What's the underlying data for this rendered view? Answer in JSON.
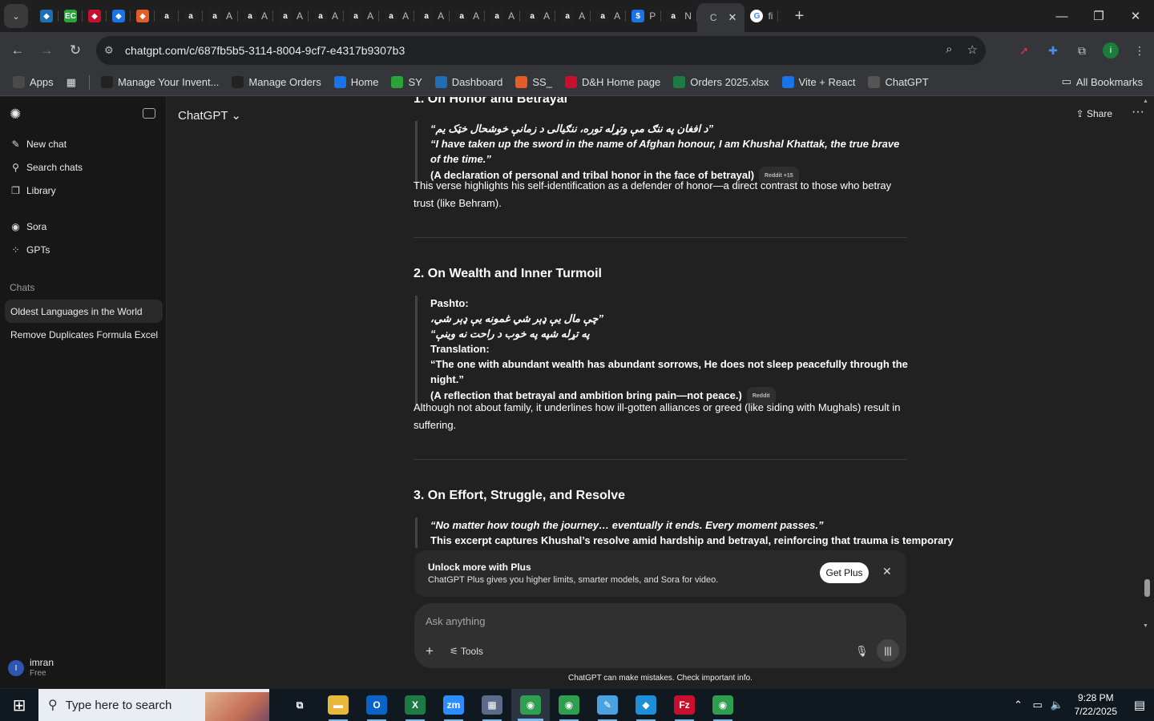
{
  "browser": {
    "tabs": [
      {
        "icon": "diamond-icon",
        "title": "",
        "color": "#1e6fb3"
      },
      {
        "icon": "ec-icon",
        "title": "",
        "color": "#2aa33b"
      },
      {
        "icon": "dh-icon",
        "title": "",
        "color": "#c8102e"
      },
      {
        "icon": "logo-icon",
        "title": "",
        "color": "#1a73e8"
      },
      {
        "icon": "stack-icon",
        "title": "",
        "color": "#e25d28"
      },
      {
        "icon": "amazon-icon",
        "title": "",
        "color": "#222222"
      },
      {
        "icon": "amazon-icon",
        "title": "",
        "color": "#222222"
      },
      {
        "icon": "amazon-icon",
        "title": "A",
        "color": "#222222"
      },
      {
        "icon": "amazon-icon",
        "title": "A",
        "color": "#222222"
      },
      {
        "icon": "amazon-icon",
        "title": "A",
        "color": "#222222"
      },
      {
        "icon": "amazon-icon",
        "title": "A",
        "color": "#222222"
      },
      {
        "icon": "amazon-icon",
        "title": "A",
        "color": "#222222"
      },
      {
        "icon": "amazon-icon",
        "title": "A",
        "color": "#222222"
      },
      {
        "icon": "amazon-icon",
        "title": "A",
        "color": "#222222"
      },
      {
        "icon": "amazon-icon",
        "title": "A",
        "color": "#222222"
      },
      {
        "icon": "amazon-icon",
        "title": "A",
        "color": "#222222"
      },
      {
        "icon": "amazon-icon",
        "title": "A",
        "color": "#222222"
      },
      {
        "icon": "amazon-icon",
        "title": "A",
        "color": "#222222"
      },
      {
        "icon": "amazon-icon",
        "title": "A",
        "color": "#222222"
      },
      {
        "icon": "dollar-icon",
        "title": "P",
        "color": "#1a73e8"
      },
      {
        "icon": "amazon-icon",
        "title": "N",
        "color": "#222222"
      }
    ],
    "active_tab": {
      "title": "C",
      "close": "✕"
    },
    "last_tab": {
      "title": "fi"
    },
    "url": "chatgpt.com/c/687fb5b5-3114-8004-9cf7-e4317b9307b3",
    "bookmarks": [
      {
        "label": "Apps",
        "color": "#4a4a4a"
      },
      {
        "label": "Manage Your Invent...",
        "color": "#222222"
      },
      {
        "label": "Manage Orders",
        "color": "#222222"
      },
      {
        "label": "Home",
        "color": "#1a73e8"
      },
      {
        "label": "SY",
        "color": "#2aa33b"
      },
      {
        "label": "Dashboard",
        "color": "#1e6fb3"
      },
      {
        "label": "SS_",
        "color": "#e25d28"
      },
      {
        "label": "D&H Home page",
        "color": "#c8102e"
      },
      {
        "label": "Orders 2025.xlsx",
        "color": "#1d7a45"
      },
      {
        "label": "Vite + React",
        "color": "#1a73e8"
      },
      {
        "label": "ChatGPT",
        "color": "#555555"
      }
    ],
    "all_bookmarks": "All Bookmarks"
  },
  "sidebar": {
    "items": [
      {
        "label": "New chat",
        "icon": "edit-icon",
        "glyph": "✎"
      },
      {
        "label": "Search chats",
        "icon": "search-icon",
        "glyph": "⚲"
      },
      {
        "label": "Library",
        "icon": "library-icon",
        "glyph": "❐"
      },
      {
        "label": "Sora",
        "icon": "sora-icon",
        "glyph": "◉"
      },
      {
        "label": "GPTs",
        "icon": "gpts-icon",
        "glyph": "⁘"
      }
    ],
    "section_label": "Chats",
    "chats": [
      {
        "label": "Oldest Languages in the World"
      },
      {
        "label": "Remove Duplicates Formula Excel"
      }
    ],
    "user": {
      "initial": "I",
      "name": "imran",
      "plan": "Free"
    }
  },
  "header": {
    "model": "ChatGPT ⌄",
    "share": "⇪ Share",
    "more": "···"
  },
  "message": {
    "section1": {
      "title": "1. On Honor and Betrayal",
      "pashto": "”د افغان په ننګ مې وتړله توره، ننګيالی د زمانې خوشحال خټک يم“",
      "translation": "“I have taken up the sword in the name of Afghan honour, I am Khushal Khattak, the true brave of the time.”",
      "note": "(A declaration of personal and tribal honor in the face of betrayal)",
      "source": "Reddit +15",
      "para": "This verse highlights his self-identification as a defender of honor—a direct contrast to those who betray trust (like Behram)."
    },
    "section2": {
      "title": "2. On Wealth and Inner Turmoil",
      "pashto_label": "Pashto:",
      "pashto_line1": "”چې مال يې ډېر شي غمونه يې ډېر شي،",
      "pashto_line2": "په تړله شپه په خوب د راحت نه وينې“",
      "translation_label": "Translation:",
      "translation": "“The one with abundant wealth has abundant sorrows, He does not sleep peacefully through the night.”",
      "note": "(A reflection that betrayal and ambition bring pain—not peace.)",
      "source": "Reddit",
      "para": "Although not about family, it underlines how ill-gotten alliances or greed (like siding with Mughals) result in suffering."
    },
    "section3": {
      "title": "3. On Effort, Struggle, and Resolve",
      "quote": "“No matter how tough the journey… eventually it ends. Every moment passes.”",
      "text": "This excerpt captures Khushal’s resolve amid hardship and betrayal, reinforcing that trauma is temporary"
    }
  },
  "banner": {
    "title": "Unlock more with Plus",
    "subtitle": "ChatGPT Plus gives you higher limits, smarter models, and Sora for video.",
    "button": "Get Plus",
    "close": "✕"
  },
  "composer": {
    "placeholder": "Ask anything",
    "tools": "⚟ Tools"
  },
  "disclaimer": "ChatGPT can make mistakes. Check important info.",
  "taskbar": {
    "search_placeholder": "Type here to search",
    "apps": [
      {
        "icon": "task-view-icon",
        "glyph": "⧉",
        "color": "#101820"
      },
      {
        "icon": "file-explorer-icon",
        "glyph": "▬",
        "color": "#e8b83a"
      },
      {
        "icon": "outlook-icon",
        "glyph": "O",
        "color": "#0a64c8"
      },
      {
        "icon": "excel-icon",
        "glyph": "X",
        "color": "#1d7a45"
      },
      {
        "icon": "zoom-icon",
        "glyph": "zm",
        "color": "#2d8cff"
      },
      {
        "icon": "calculator-icon",
        "glyph": "▦",
        "color": "#5a6a88"
      },
      {
        "icon": "chrome-icon",
        "glyph": "◉",
        "color": "#2e9e4f"
      },
      {
        "icon": "chrome-icon",
        "glyph": "◉",
        "color": "#2e9e4f"
      },
      {
        "icon": "notepad-icon",
        "glyph": "✎",
        "color": "#4aa3df"
      },
      {
        "icon": "app-icon",
        "glyph": "◆",
        "color": "#1e8fd6"
      },
      {
        "icon": "filezilla-icon",
        "glyph": "Fz",
        "color": "#c8102e"
      },
      {
        "icon": "chrome-profile-icon",
        "glyph": "◉",
        "color": "#2e9e4f"
      }
    ],
    "time": "9:28 PM",
    "date": "7/22/2025"
  }
}
